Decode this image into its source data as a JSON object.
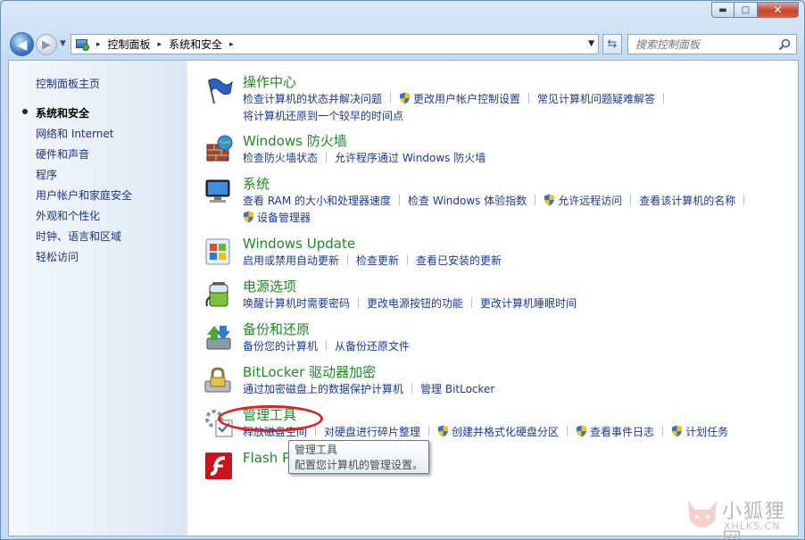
{
  "window": {
    "min_symbol": "▬",
    "max_symbol": "□",
    "close_symbol": "✕"
  },
  "address": {
    "crumbs": [
      "控制面板",
      "系统和安全"
    ],
    "crumb_arrow": "▸"
  },
  "search": {
    "placeholder": "搜索控制面板"
  },
  "sidebar": {
    "home": "控制面板主页",
    "items": [
      {
        "label": "系统和安全",
        "active": true
      },
      {
        "label": "网络和 Internet"
      },
      {
        "label": "硬件和声音"
      },
      {
        "label": "程序"
      },
      {
        "label": "用户帐户和家庭安全"
      },
      {
        "label": "外观和个性化"
      },
      {
        "label": "时钟、语言和区域"
      },
      {
        "label": "轻松访问"
      }
    ]
  },
  "categories": {
    "action_center": {
      "title": "操作中心",
      "links": [
        "检查计算机的状态并解决问题",
        "更改用户帐户控制设置",
        "常见计算机问题疑难解答",
        "将计算机还原到一个较早的时间点"
      ]
    },
    "firewall": {
      "title": "Windows 防火墙",
      "links": [
        "检查防火墙状态",
        "允许程序通过 Windows 防火墙"
      ]
    },
    "system": {
      "title": "系统",
      "links": [
        "查看 RAM 的大小和处理器速度",
        "检查 Windows 体验指数",
        "允许远程访问",
        "查看该计算机的名称",
        "设备管理器"
      ]
    },
    "update": {
      "title": "Windows Update",
      "links": [
        "启用或禁用自动更新",
        "检查更新",
        "查看已安装的更新"
      ]
    },
    "power": {
      "title": "电源选项",
      "links": [
        "唤醒计算机时需要密码",
        "更改电源按钮的功能",
        "更改计算机睡眠时间"
      ]
    },
    "backup": {
      "title": "备份和还原",
      "links": [
        "备份您的计算机",
        "从备份还原文件"
      ]
    },
    "bitlocker": {
      "title": "BitLocker 驱动器加密",
      "links": [
        "通过加密磁盘上的数据保护计算机",
        "管理 BitLocker"
      ]
    },
    "admin_tools": {
      "title": "管理工具",
      "links": [
        "释放磁盘空间",
        "对硬盘进行碎片整理",
        "创建并格式化硬盘分区",
        "查看事件日志",
        "计划任务"
      ]
    },
    "flash": {
      "title": "Flash P"
    }
  },
  "tooltip": {
    "title": "管理工具",
    "text": "配置您计算机的管理设置。"
  },
  "watermark": {
    "text": "小狐狸网",
    "sub": "XHLKS.CN"
  },
  "colors": {
    "category_title": "#1f8a24",
    "link": "#1a3a96",
    "highlight": "#e21e1e"
  }
}
